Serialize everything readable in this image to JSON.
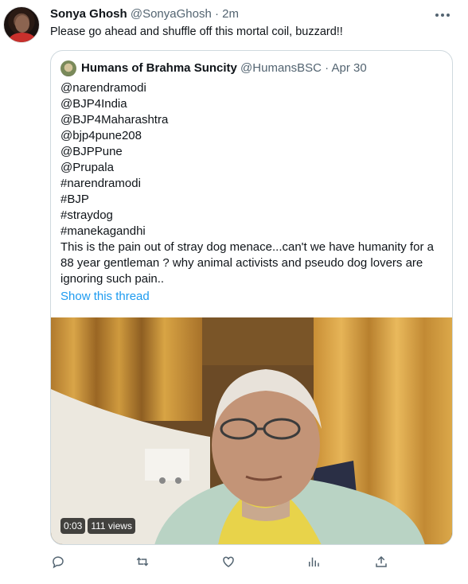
{
  "author": {
    "name": "Sonya Ghosh",
    "handle": "@SonyaGhosh",
    "separator": "·",
    "time": "2m"
  },
  "tweet_text": "Please go ahead and shuffle off this mortal coil, buzzard!!",
  "quoted": {
    "name": "Humans of Brahma Suncity",
    "handle": "@HumansBSC",
    "separator": "·",
    "date": "Apr 30",
    "lines": [
      "@narendramodi",
      "@BJP4India",
      "@BJP4Maharashtra",
      "@bjp4pune208",
      "@BJPPune",
      "@Prupala",
      "#narendramodi",
      "#BJP",
      "#straydog",
      "#manekagandhi"
    ],
    "body": "This is the pain out of stray dog menace...can't we have humanity for a 88 year gentleman ? why animal activists and pseudo dog lovers are ignoring such pain..",
    "show_thread": "Show this thread",
    "video": {
      "duration": "0:03",
      "views": "111 views"
    }
  },
  "actions": [
    "reply-icon",
    "retweet-icon",
    "like-icon",
    "analytics-icon",
    "share-icon"
  ],
  "colors": {
    "link": "#1d9bf0",
    "secondary": "#536471",
    "border": "#cfd9de"
  }
}
